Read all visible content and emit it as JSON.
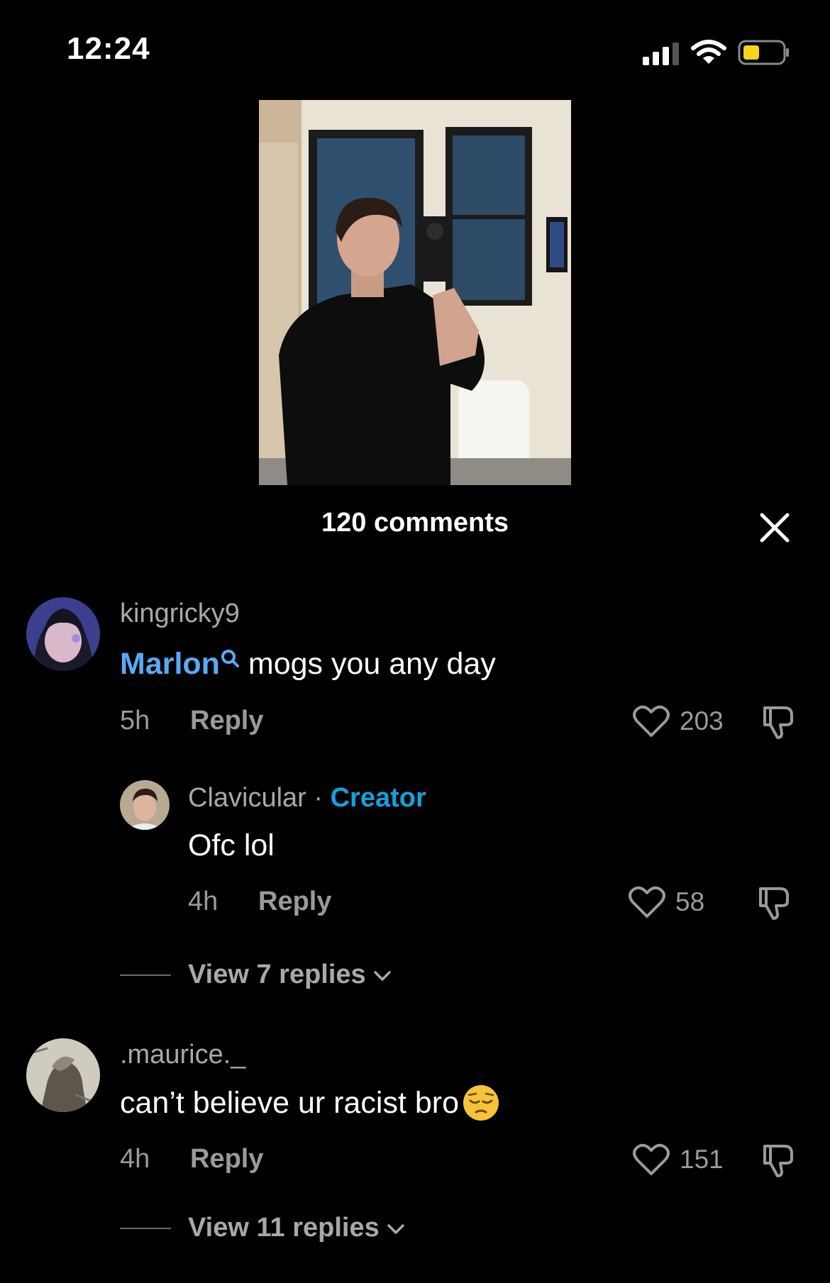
{
  "status_bar": {
    "time": "12:24"
  },
  "sheet": {
    "comment_count_label": "120 comments"
  },
  "comments": [
    {
      "username": "kingricky9",
      "mention": "Marlon",
      "text": " mogs you any day",
      "time": "5h",
      "reply_label": "Reply",
      "likes": "203",
      "replies": [
        {
          "username": "Clavicular",
          "separator": " · ",
          "badge": "Creator",
          "text": "Ofc lol",
          "time": "4h",
          "reply_label": "Reply",
          "likes": "58"
        }
      ],
      "view_replies": "View 7 replies"
    },
    {
      "username": ".maurice._",
      "text": "can’t believe ur racist bro",
      "emoji": "😔",
      "time": "4h",
      "reply_label": "Reply",
      "likes": "151",
      "view_replies": "View 11 replies"
    }
  ]
}
